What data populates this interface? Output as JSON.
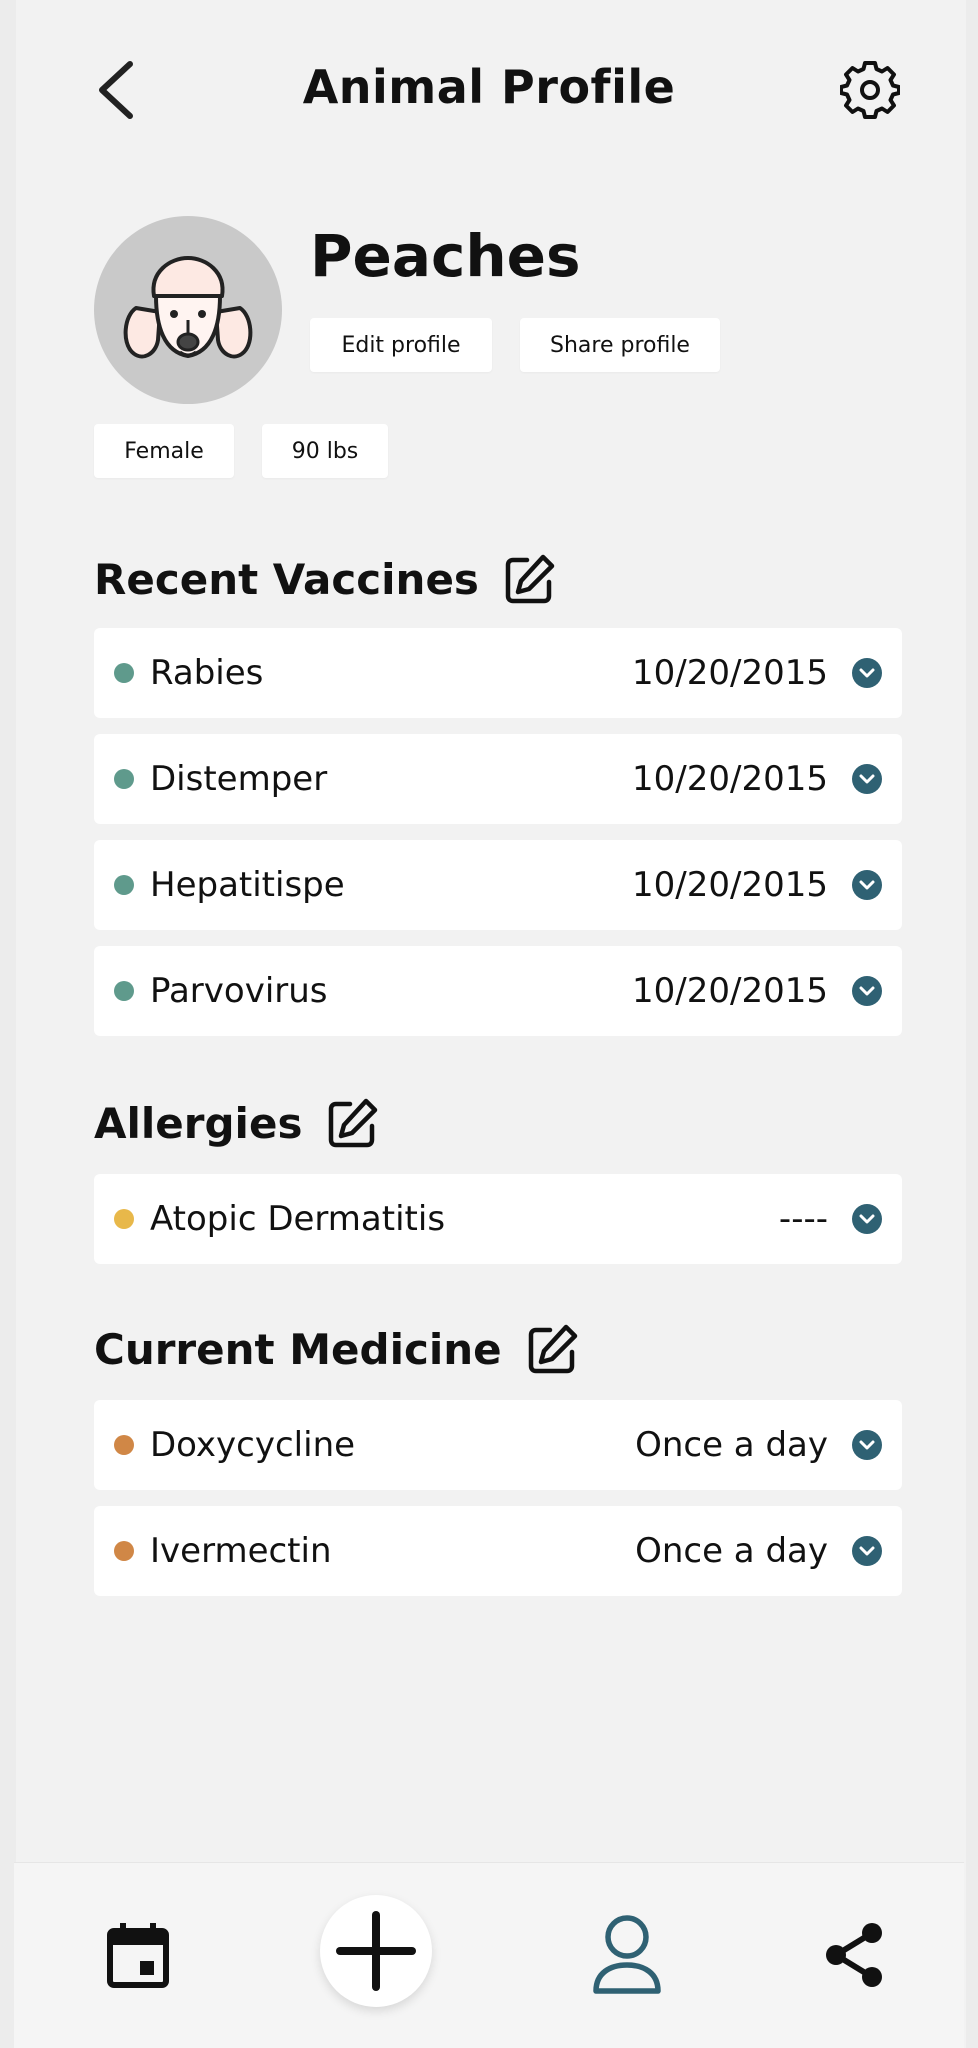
{
  "header": {
    "title": "Animal Profile"
  },
  "profile": {
    "name": "Peaches",
    "edit_label": "Edit profile",
    "share_label": "Share profile",
    "sex": "Female",
    "weight": "90 lbs"
  },
  "vaccines": {
    "title": "Recent Vaccines",
    "items": [
      {
        "name": "Rabies",
        "value": "10/20/2015"
      },
      {
        "name": "Distemper",
        "value": "10/20/2015"
      },
      {
        "name": "Hepatitispe",
        "value": "10/20/2015"
      },
      {
        "name": "Parvovirus",
        "value": "10/20/2015"
      }
    ]
  },
  "allergies": {
    "title": "Allergies",
    "items": [
      {
        "name": "Atopic Dermatitis",
        "value": "----"
      }
    ]
  },
  "medicine": {
    "title": "Current Medicine",
    "items": [
      {
        "name": "Doxycycline",
        "value": "Once a day"
      },
      {
        "name": "Ivermectin",
        "value": "Once a day"
      }
    ]
  },
  "icons": {
    "back": "chevron-left-icon",
    "settings": "gear-icon",
    "edit": "edit-square-icon",
    "expand": "chevron-down-icon",
    "calendar": "calendar-icon",
    "add": "plus-icon",
    "profile": "user-icon",
    "share": "share-icon"
  },
  "colors": {
    "vaccine_dot": "#5f9a8c",
    "allergy_dot": "#e8b84a",
    "medicine_dot": "#d08746",
    "chevron_bg": "#2f6173",
    "active_nav": "#2f6173"
  }
}
